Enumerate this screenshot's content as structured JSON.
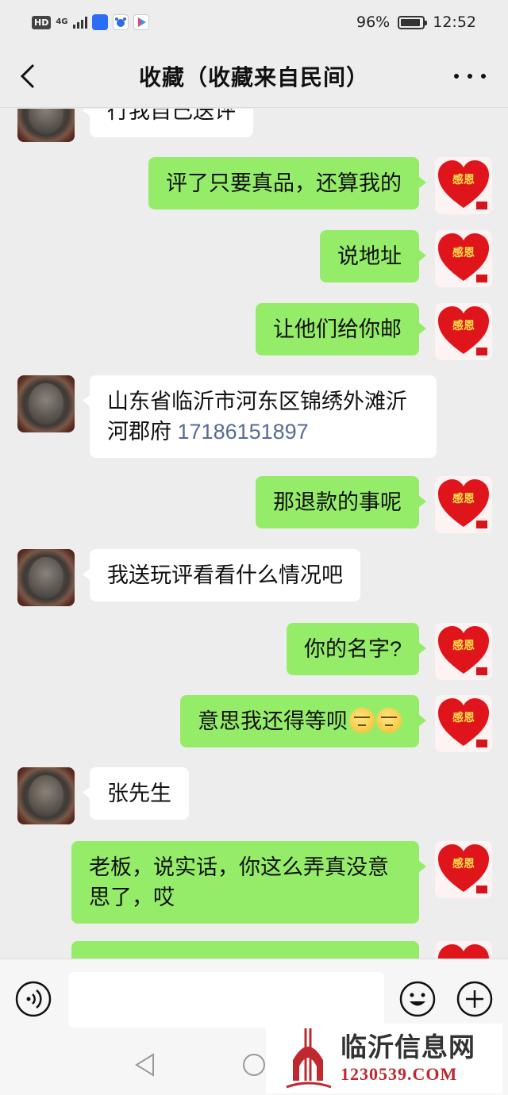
{
  "status_bar": {
    "hd_badge": "HD",
    "network": "4G",
    "battery_percent": "96%",
    "time": "12:52",
    "icons": [
      "hd-icon",
      "signal-icon",
      "app-icon",
      "baidu-icon",
      "youku-icon",
      "battery-icon"
    ]
  },
  "header": {
    "title": "收藏（收藏来自民间）",
    "back_icon": "chevron-left-icon",
    "more_icon": "more-icon"
  },
  "messages": [
    {
      "side": "left",
      "text": "行我自己送评"
    },
    {
      "side": "right",
      "text": "评了只要真品，还算我的"
    },
    {
      "side": "right",
      "text": "说地址"
    },
    {
      "side": "right",
      "text": "让他们给你邮"
    },
    {
      "side": "left",
      "text": "山东省临沂市河东区锦绣外滩沂河郡府",
      "phone": "17186151897"
    },
    {
      "side": "right",
      "text": "那退款的事呢"
    },
    {
      "side": "left",
      "text": "我送玩评看看什么情况吧"
    },
    {
      "side": "right",
      "text": "你的名字?"
    },
    {
      "side": "right",
      "text": "意思我还得等呗",
      "emojis": [
        "sweat-smile-emoji",
        "sweat-smile-emoji"
      ]
    },
    {
      "side": "left",
      "text": "张先生"
    },
    {
      "side": "right",
      "text": "老板，说实话，你这么弄真没意思了，哎"
    },
    {
      "side": "right",
      "text": ""
    }
  ],
  "avatars": {
    "left": "coin-avatar",
    "right": "heart-avatar",
    "right_avatar_text": "感恩"
  },
  "input_bar": {
    "value": "",
    "placeholder": "",
    "voice_icon": "voice-icon",
    "emoji_icon": "emoji-icon",
    "add_icon": "plus-icon"
  },
  "nav_bar": {
    "icons": [
      "nav-back-icon",
      "nav-home-icon"
    ]
  },
  "watermark": {
    "title": "临沂信息网",
    "url": "1230539.COM"
  },
  "colors": {
    "background": "#ededed",
    "sent_bubble": "#95ec69",
    "received_bubble": "#ffffff",
    "phone_link": "#576b95",
    "watermark_red": "#c0282f"
  }
}
